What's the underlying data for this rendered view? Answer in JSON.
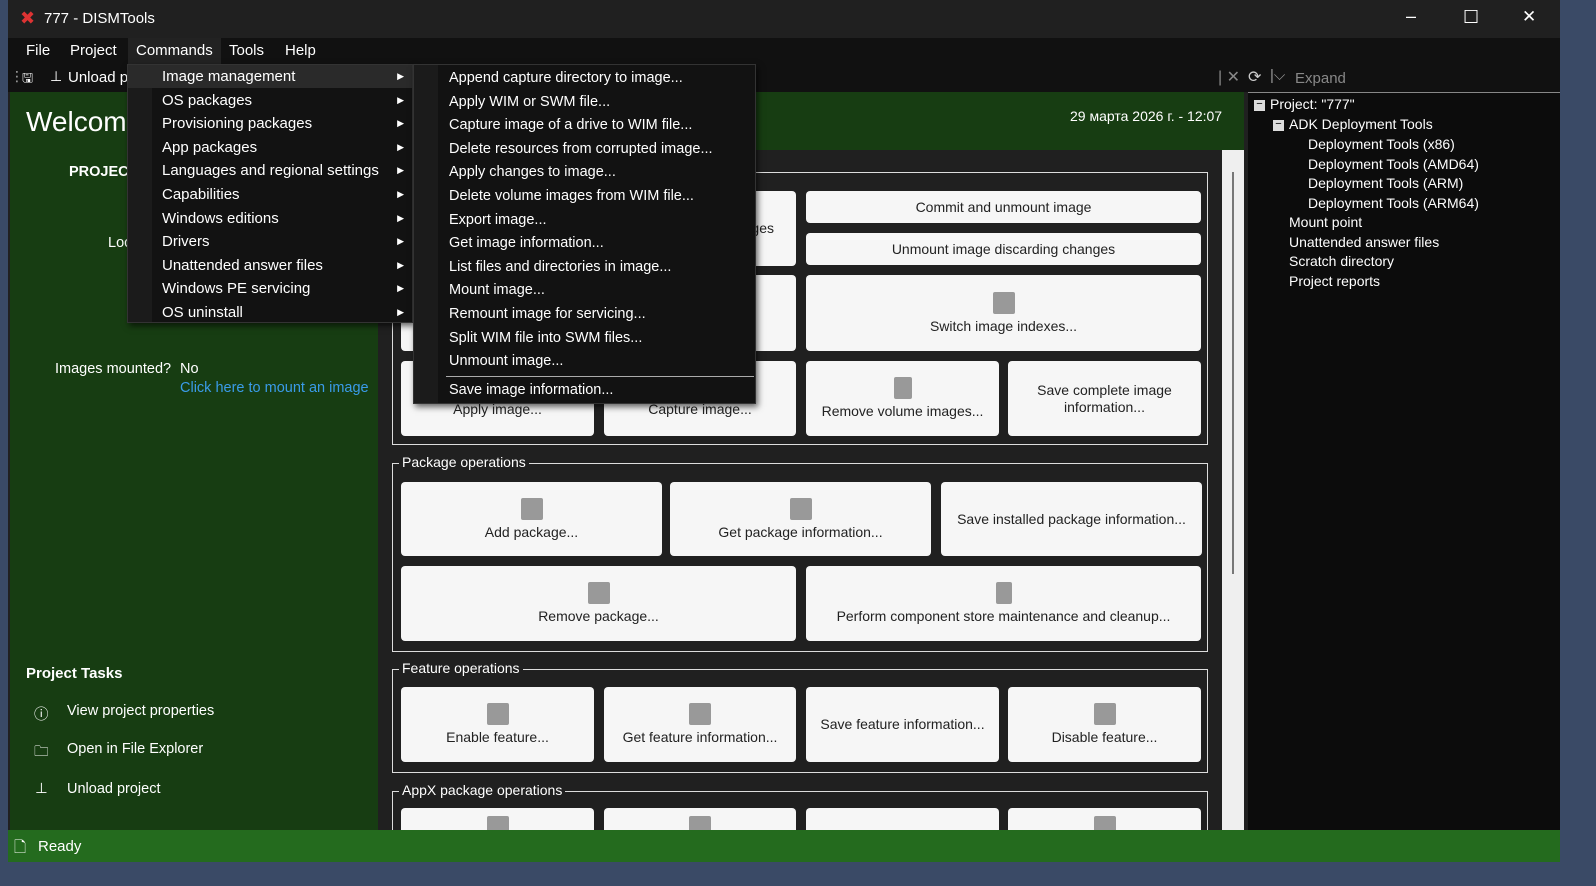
{
  "window": {
    "title": "777 - DISMTools",
    "min": "–",
    "max": "☐",
    "close": "✕"
  },
  "menubar": [
    "File",
    "Project",
    "Commands",
    "Tools",
    "Help"
  ],
  "toolbar": {
    "unload": "Unload p",
    "expand": "Expand"
  },
  "commands_menu": [
    "Image management",
    "OS packages",
    "Provisioning packages",
    "App packages",
    "Languages and regional settings",
    "Capabilities",
    "Windows editions",
    "Drivers",
    "Unattended answer files",
    "Windows PE servicing",
    "OS uninstall"
  ],
  "image_submenu": [
    "Append capture directory to image...",
    "Apply WIM or SWM file...",
    "Capture image of a drive to WIM file...",
    "Delete resources from corrupted image...",
    "Apply changes to image...",
    "Delete volume images from WIM file...",
    "Export image...",
    "Get image information...",
    "List files and directories in image...",
    "Mount image...",
    "Remount image for servicing...",
    "Split WIM file into SWM files...",
    "Unmount image..."
  ],
  "image_submenu_last": "Save image information...",
  "left": {
    "welcome": "Welcome",
    "project_label": "PROJECT",
    "loc": "Loc",
    "images_mounted_label": "Images mounted?",
    "images_mounted_value": "No",
    "mount_link": "Click here to mount an image",
    "tasks_title": "Project Tasks",
    "tasks": [
      "View project properties",
      "Open in File Explorer",
      "Unload project"
    ]
  },
  "header": {
    "datetime": "29 марта 2026 г. - 12:07"
  },
  "image_ops": {
    "partial": "ges",
    "commit": "Commit and unmount image",
    "discard": "Unmount image discarding changes",
    "switch": "Switch image indexes...",
    "apply": "Apply image...",
    "capture": "Capture image...",
    "remove_vol": "Remove volume images...",
    "save_complete": "Save complete image information..."
  },
  "package_ops": {
    "title": "Package operations",
    "buttons": [
      "Add package...",
      "Get package information...",
      "Save installed package information...",
      "Remove package...",
      "Perform component store maintenance and cleanup..."
    ]
  },
  "feature_ops": {
    "title": "Feature operations",
    "buttons": [
      "Enable feature...",
      "Get feature information...",
      "Save feature information...",
      "Disable feature..."
    ]
  },
  "appx_ops": {
    "title": "AppX package operations"
  },
  "tree": {
    "root": "Project: \"777\"",
    "adk": "ADK Deployment Tools",
    "adk_children": [
      "Deployment Tools (x86)",
      "Deployment Tools (AMD64)",
      "Deployment Tools (ARM)",
      "Deployment Tools (ARM64)"
    ],
    "items": [
      "Mount point",
      "Unattended answer files",
      "Scratch directory",
      "Project reports"
    ]
  },
  "status": {
    "text": "Ready"
  },
  "colors": {
    "green": "#173d12",
    "status": "#246b1e",
    "link": "#3a9be8"
  }
}
